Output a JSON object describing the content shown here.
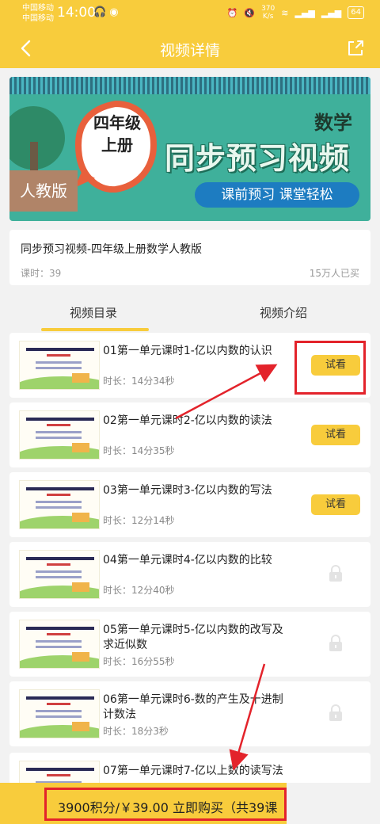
{
  "status_bar": {
    "carrier_1": "中国移动",
    "carrier_2": "中国移动",
    "time": "14:00",
    "net_speed_value": "370",
    "net_speed_unit": "K/s",
    "battery": "64"
  },
  "nav": {
    "title": "视频详情",
    "back_icon": "chevron-left-icon",
    "share_icon": "share-icon"
  },
  "banner": {
    "grade_line_1": "四年级",
    "grade_line_2": "上册",
    "edition": "人教版",
    "subject": "数学",
    "title": "同步预习视频",
    "tagline": "课前预习 课堂轻松"
  },
  "course_info": {
    "title": "同步预习视频-四年级上册数学人教版",
    "lessons": "课时：39",
    "learners": "15万人已买"
  },
  "tabs": [
    {
      "label": "视频目录",
      "active": true
    },
    {
      "label": "视频介绍",
      "active": false
    }
  ],
  "lessons": [
    {
      "title": "01第一单元课时1-亿以内数的认识",
      "duration": "时长：14分34秒",
      "action": "试看"
    },
    {
      "title": "02第一单元课时2-亿以内数的读法",
      "duration": "时长：14分35秒",
      "action": "试看"
    },
    {
      "title": "03第一单元课时3-亿以内数的写法",
      "duration": "时长：12分14秒",
      "action": "试看"
    },
    {
      "title": "04第一单元课时4-亿以内数的比较",
      "duration": "时长：12分40秒",
      "action": "locked"
    },
    {
      "title": "05第一单元课时5-亿以内数的改写及求近似数",
      "duration": "时长：16分55秒",
      "action": "locked"
    },
    {
      "title": "06第一单元课时6-数的产生及十进制计数法",
      "duration": "时长：18分3秒",
      "action": "locked"
    },
    {
      "title": "07第一单元课时7-亿以上数的读写法",
      "duration": "",
      "action": ""
    }
  ],
  "purchase": {
    "label": "3900积分/￥39.00 立即购买（共39课"
  },
  "colors": {
    "accent": "#f8cc3c",
    "annotation": "#e3232b"
  }
}
